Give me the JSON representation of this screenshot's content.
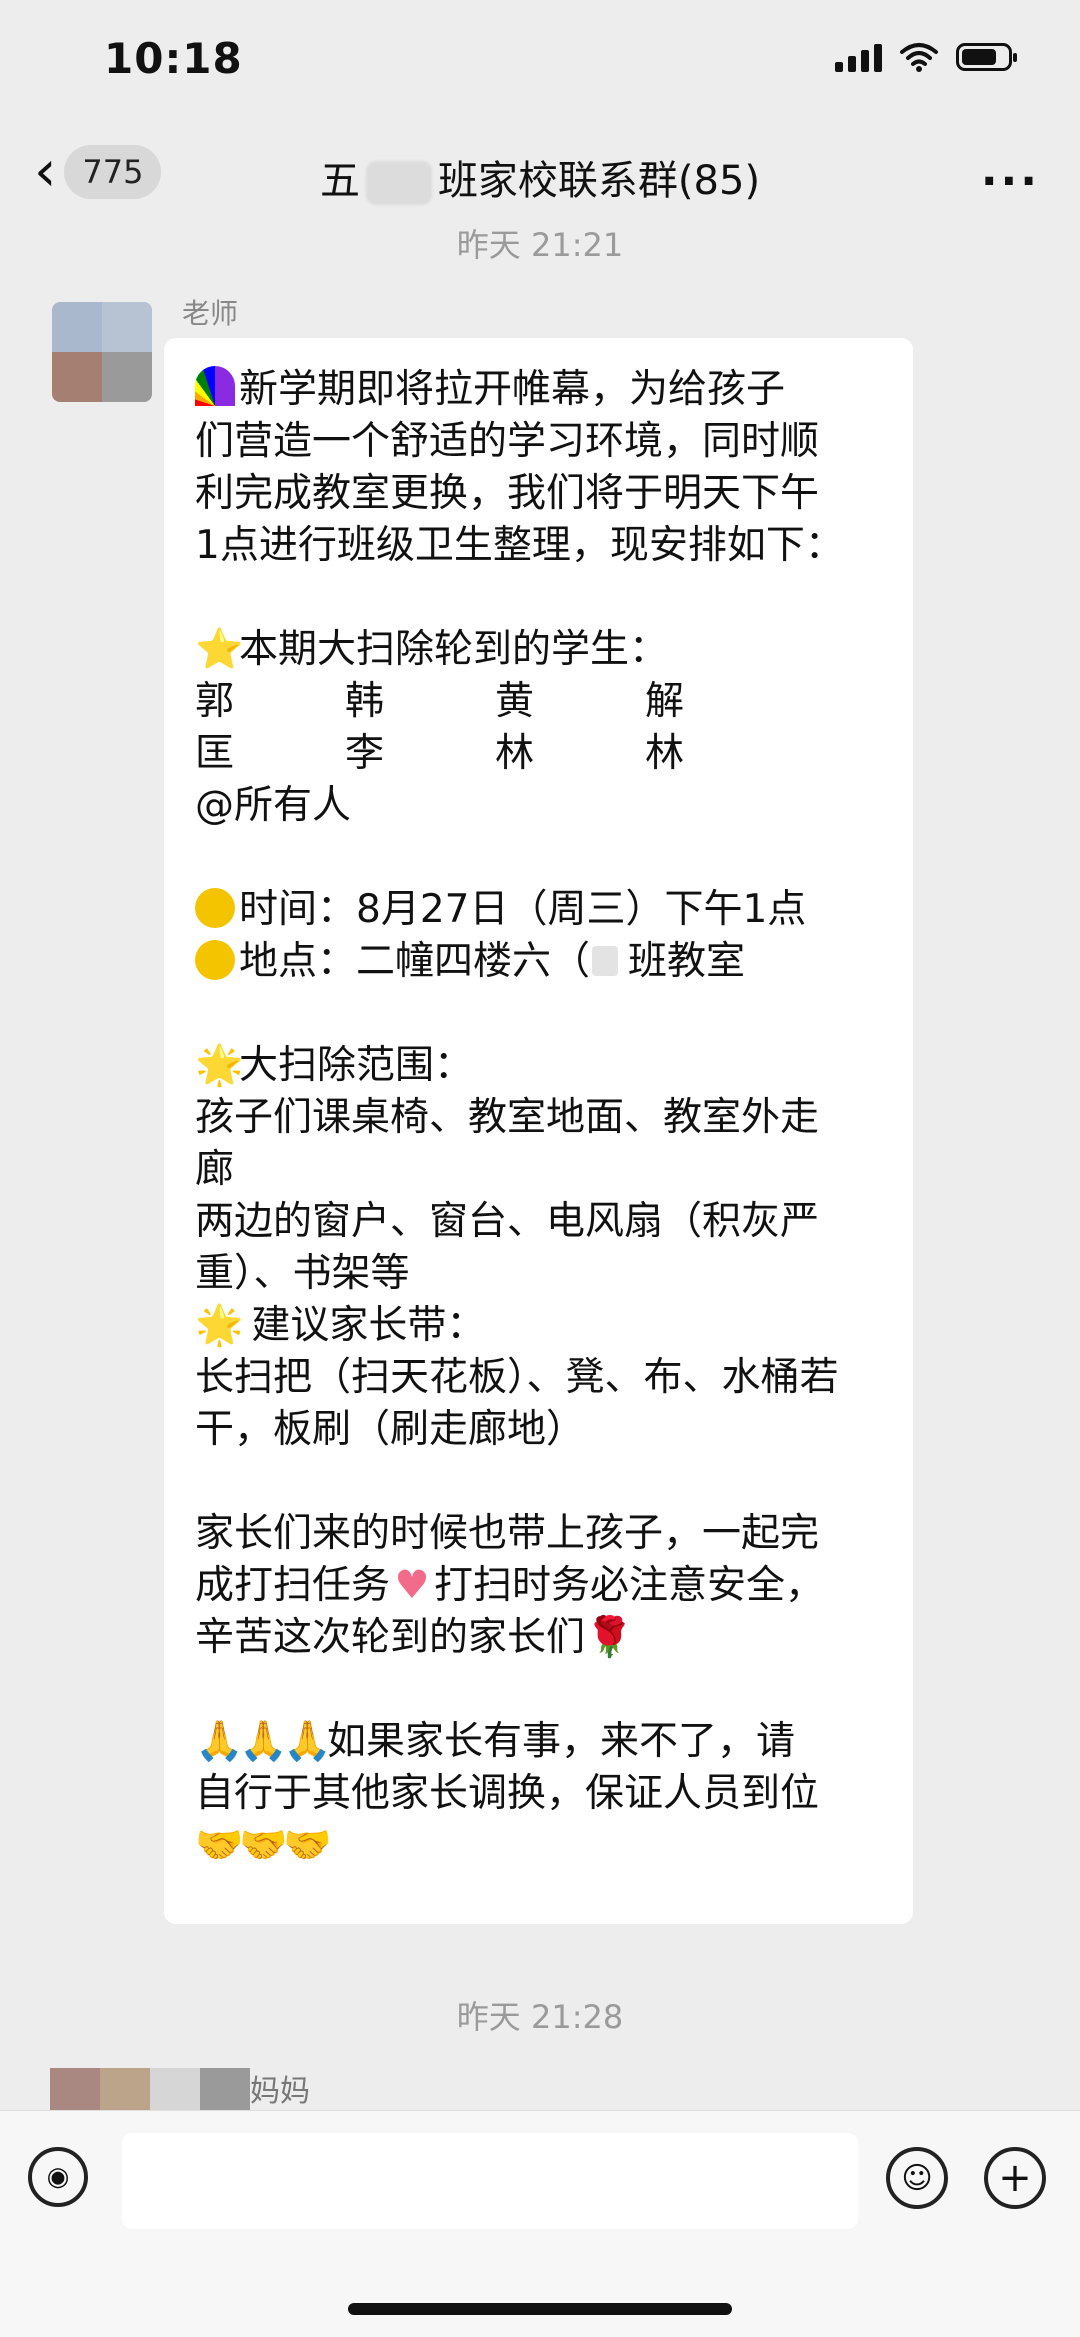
{
  "status_bar": {
    "time": "10:18"
  },
  "nav": {
    "back_count": "775",
    "title_prefix": "五",
    "title_suffix": "班家校联系群(85)",
    "more": "···"
  },
  "timestamp_1": "昨天 21:21",
  "sender_1": "老师",
  "message": {
    "line1": "新学期即将拉开帷幕，为给孩子",
    "line2": "们营造一个舒适的学习环境，同时顺",
    "line3": "利完成教室更换，我们将于明天下午",
    "line4": "1点进行班级卫生整理，现安排如下：",
    "students_heading": "本期大扫除轮到的学生：",
    "names_row1": [
      "郭",
      "韩",
      "黄",
      "解"
    ],
    "names_row2": [
      "匡",
      "李",
      "林",
      "林"
    ],
    "mention": "@所有人",
    "time_line": "时间：8月27日（周三）下午1点",
    "place_line_a": "地点：二幢四楼六（",
    "place_line_b": "班教室",
    "scope_heading": "大扫除范围：",
    "scope1": "孩子们课桌椅、教室地面、教室外走",
    "scope2": "廊",
    "scope3": "两边的窗户、窗台、电风扇（积灰严",
    "scope4": "重）、书架等",
    "bring_heading": " 建议家长带：",
    "bring1": "长扫把（扫天花板）、凳、布、水桶若",
    "bring2": "干，板刷（刷走廊地）",
    "p1": "家长们来的时候也带上孩子，一起完",
    "p2a": "成打扫任务",
    "p2b": "打扫时务必注意安全，",
    "p3": "辛苦这次轮到的家长们",
    "q1": "如果家长有事，来不了，请",
    "q2": "自行于其他家长调换，保证人员到位"
  },
  "emoji_names": {
    "rainbow": "rainbow-icon",
    "star": "star-icon",
    "sparkle_star": "glowing-star-icon",
    "dot": "yellow-circle-icon",
    "heart": "heart-icon",
    "rose": "rose-icon",
    "pray": "pray-hands-icon",
    "handshake": "handshake-icon"
  },
  "timestamp_2": "昨天 21:28",
  "sender_2": "妈妈",
  "colors": {
    "background": "#ededed",
    "bubble": "#ffffff",
    "timestamp": "#9a9a9a"
  }
}
